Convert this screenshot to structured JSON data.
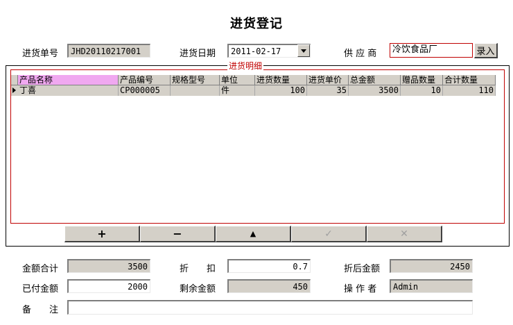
{
  "title": "进货登记",
  "header": {
    "order_no_label": "进货单号",
    "order_no": "JHD20110217001",
    "date_label": "进货日期",
    "date": "2011-02-17",
    "supplier_label": "供 应 商",
    "supplier": "冷饮食品厂",
    "enter_button": "录入"
  },
  "detail": {
    "group_title": "进货明细",
    "columns": [
      "产品名称",
      "产品编号",
      "规格型号",
      "单位",
      "进货数量",
      "进货单价",
      "总金额",
      "赠品数量",
      "合计数量"
    ],
    "rows": [
      {
        "name": "丁喜",
        "code": "CP000005",
        "spec": "",
        "unit": "件",
        "qty": "100",
        "price": "35",
        "total": "3500",
        "gift": "10",
        "sum_qty": "110"
      }
    ]
  },
  "nav": {
    "add": "+",
    "remove": "−",
    "up": "▲",
    "confirm": "✓",
    "cancel": "✕"
  },
  "footer": {
    "amount_total_label": "金额合计",
    "amount_total": "3500",
    "discount_label": "折　　扣",
    "discount": "0.7",
    "after_discount_label": "折后金额",
    "after_discount": "2450",
    "paid_label": "已付金额",
    "paid": "2000",
    "remaining_label": "剩余金额",
    "remaining": "450",
    "operator_label": "操 作 者",
    "operator": "Admin",
    "remark_label": "备　　注",
    "remark": ""
  },
  "colors": {
    "accent_red": "#c00000",
    "selected_header": "#f0a8f0",
    "control_gray": "#d4d0c8"
  }
}
